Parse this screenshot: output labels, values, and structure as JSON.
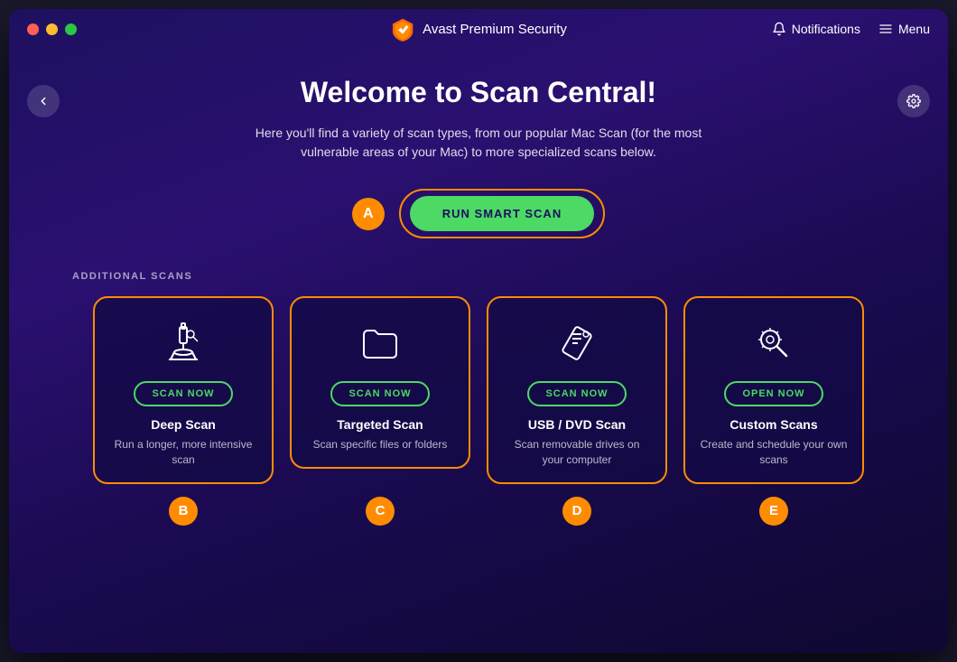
{
  "window": {
    "title": "Avast Premium Security"
  },
  "titlebar": {
    "notifications_label": "Notifications",
    "menu_label": "Menu"
  },
  "main": {
    "heading": "Welcome to Scan Central!",
    "subtitle": "Here you'll find a variety of scan types, from our popular Mac Scan (for the most vulnerable areas of your Mac) to more specialized scans below.",
    "smart_scan_button": "RUN SMART SCAN",
    "badge_a": "A",
    "additional_scans_label": "ADDITIONAL SCANS",
    "cards": [
      {
        "id": "deep-scan",
        "badge": "B",
        "button_label": "SCAN NOW",
        "title": "Deep Scan",
        "description": "Run a longer, more intensive scan"
      },
      {
        "id": "targeted-scan",
        "badge": "C",
        "button_label": "SCAN NOW",
        "title": "Targeted Scan",
        "description": "Scan specific files or folders"
      },
      {
        "id": "usb-dvd-scan",
        "badge": "D",
        "button_label": "SCAN NOW",
        "title": "USB / DVD Scan",
        "description": "Scan removable drives on your computer"
      },
      {
        "id": "custom-scans",
        "badge": "E",
        "button_label": "OPEN NOW",
        "title": "Custom Scans",
        "description": "Create and schedule your own scans"
      }
    ]
  },
  "colors": {
    "orange": "#ff8c00",
    "green": "#4cd964",
    "bg_dark": "#1a1060"
  }
}
